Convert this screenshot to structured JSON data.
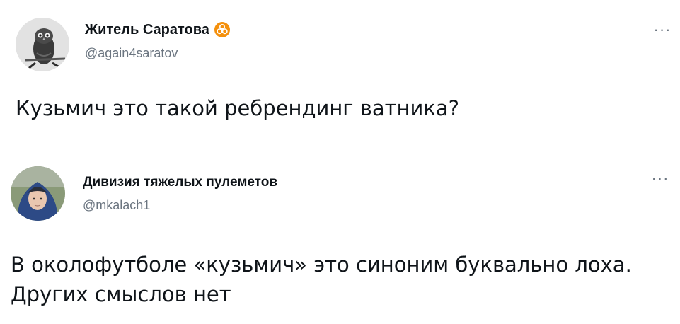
{
  "tweets": [
    {
      "display_name": "Житель Саратова",
      "badge_icon": "biohazard-badge-icon",
      "handle": "@again4saratov",
      "more_icon": "more-options-icon",
      "more_label": "···",
      "text": "Кузьмич это такой ребрендинг ватника?",
      "avatar": "owl-avatar"
    },
    {
      "display_name": "Дивизия тяжелых пулеметов",
      "handle": "@mkalach1",
      "more_icon": "more-options-icon",
      "more_label": "···",
      "text": "В околофутболе «кузьмич» это синоним буквально лоха. Других смыслов нет",
      "avatar": "person-hood-avatar"
    }
  ],
  "colors": {
    "text": "#0f1419",
    "secondary": "#6b7580",
    "badge": "#f4900c"
  }
}
